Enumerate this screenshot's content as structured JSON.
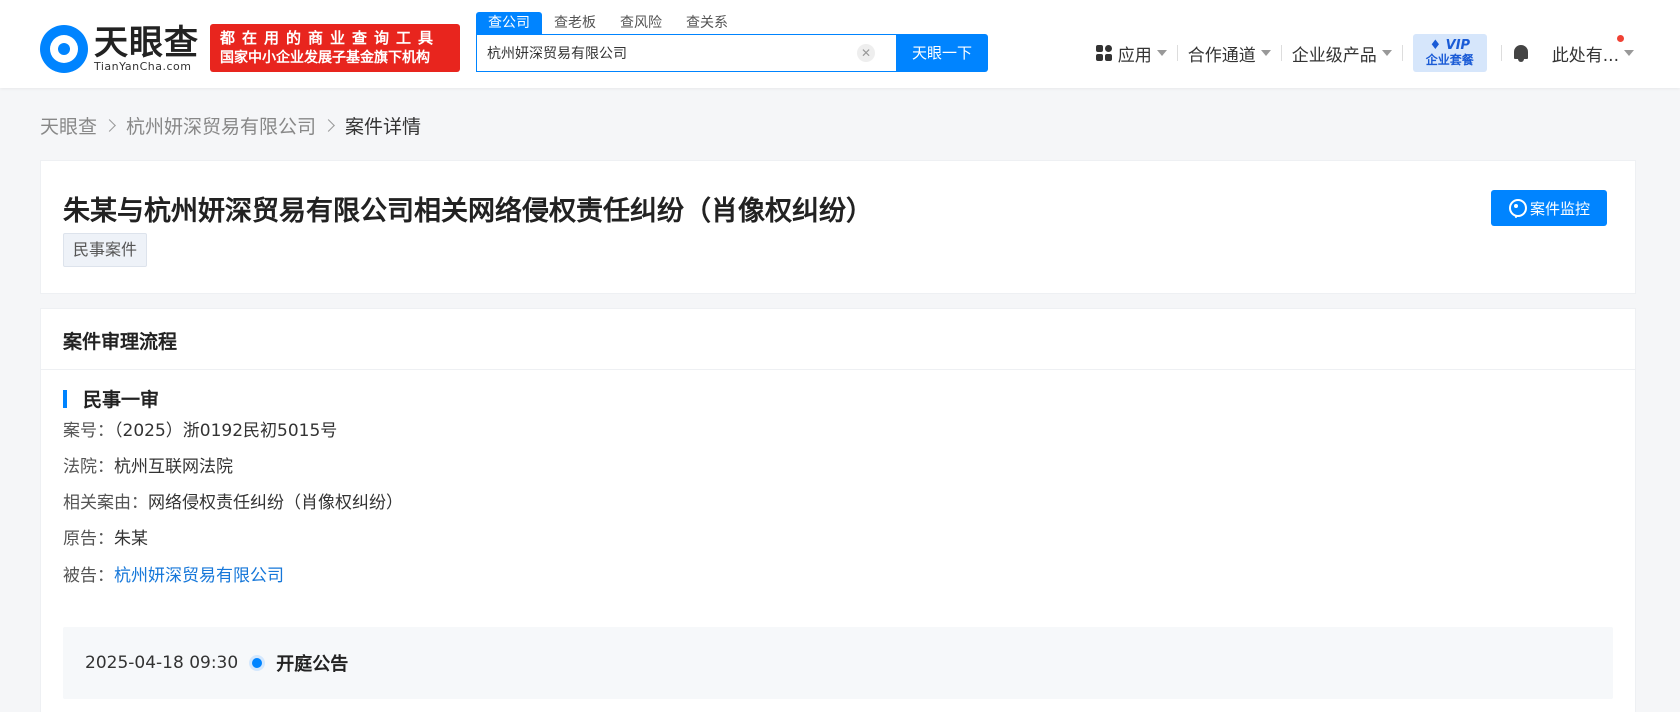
{
  "header": {
    "logo_cn": "天眼查",
    "logo_en": "TianYanCha.com",
    "slogan_line1": "都在用的商业查询工具",
    "slogan_line2": "国家中小企业发展子基金旗下机构",
    "search_tabs": [
      "查公司",
      "查老板",
      "查风险",
      "查关系"
    ],
    "search_value": "杭州妍深贸易有限公司",
    "search_button": "天眼一下",
    "nav": {
      "apps": "应用",
      "partner": "合作通道",
      "enterprise": "企业级产品",
      "vip_top": "VIP",
      "vip_bottom": "企业套餐",
      "user": "此处有..."
    }
  },
  "breadcrumb": [
    "天眼查",
    "杭州妍深贸易有限公司",
    "案件详情"
  ],
  "case": {
    "title": "朱某与杭州妍深贸易有限公司相关网络侵权责任纠纷（肖像权纠纷）",
    "tag": "民事案件",
    "monitor_button": "案件监控"
  },
  "process": {
    "section_title": "案件审理流程",
    "stage_title": "民事一审",
    "fields": {
      "case_no_label": "案号：",
      "case_no": "（2025）浙0192民初5015号",
      "court_label": "法院：",
      "court": "杭州互联网法院",
      "cause_label": "相关案由：",
      "cause": "网络侵权责任纠纷（肖像权纠纷）",
      "plaintiff_label": "原告：",
      "plaintiff": "朱某",
      "defendant_label": "被告：",
      "defendant": "杭州妍深贸易有限公司"
    },
    "timeline": {
      "time": "2025-04-18 09:30",
      "event": "开庭公告"
    }
  },
  "colors": {
    "brand_blue": "#0084ff",
    "slogan_red": "#e8251e",
    "link_blue": "#1677d9"
  }
}
